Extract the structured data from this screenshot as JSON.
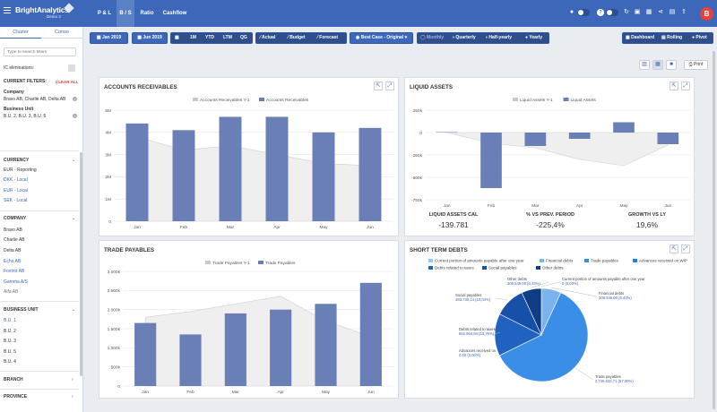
{
  "app": {
    "name": "BrightAnalytics",
    "company": "Demo 3"
  },
  "nav": {
    "tabs": [
      "P & L",
      "B / S",
      "Ratio",
      "Cashflow"
    ],
    "active": "B / S"
  },
  "user": {
    "initial": "B"
  },
  "sidebar": {
    "tabs": [
      "Cluster",
      "Conso"
    ],
    "search_placeholder": "Type to search filters",
    "ic_eliminations": "IC eliminations:",
    "current_filters": "CURRENT FILTERS:",
    "clear_all": "CLEAR ALL",
    "filter_company_label": "Company",
    "filter_company_value": "Bravo AB, Charlie AB, Delta AB",
    "filter_bu_label": "Business Unit",
    "filter_bu_value": "B.U. 2, B.U. 3, B.U. 5",
    "currency_head": "CURRENCY",
    "currencies": [
      "EUR - Reporting",
      "DKK - Local",
      "EUR - Local",
      "SEK - Local"
    ],
    "company_head": "COMPANY",
    "companies": [
      "Bravo AB",
      "Charlie AB",
      "Delta AB",
      "Echo AB",
      "Foxtrot AB",
      "Gamma A/S",
      "Alfa AB"
    ],
    "bu_head": "BUSINESS UNIT",
    "business_units": [
      "B.U. 1",
      "B.U. 2",
      "B.U. 3",
      "B.U. 5",
      "B.U. 4"
    ],
    "branch_head": "BRANCH",
    "province_head": "PROVINCE"
  },
  "toolbar": {
    "from": "Jan 2019",
    "to": "Jun 2019",
    "periods": [
      "1M",
      "YTD",
      "LTM",
      "QG"
    ],
    "actual": "Actual",
    "budget": "Budget",
    "forecast": "Forecast",
    "scenario": "Best Case - Original",
    "monthly": "Monthly",
    "quarterly": "Quarterly",
    "halfyearly": "Half-yearly",
    "yearly": "Yearly",
    "dashboard": "Dashboard",
    "rolling": "Rolling",
    "pivot": "Pivot",
    "print": "Print"
  },
  "cards": {
    "ar": {
      "title": "ACCOUNTS RECEIVABLES",
      "legend_prev": "Accounts Receivables Y-1",
      "legend_cur": "Accounts Receivables"
    },
    "la": {
      "title": "LIQUID ASSETS",
      "legend_prev": "Liquid Assets Y-1",
      "legend_cur": "Liquid Assets",
      "kpis": [
        {
          "label": "LIQUID ASSETS CAL",
          "value": "-139.781"
        },
        {
          "label": "% VS PREV. PERIOD",
          "value": "-225,4%"
        },
        {
          "label": "GROWTH VS LY",
          "value": "19,6%"
        }
      ]
    },
    "tp": {
      "title": "TRADE PAYABLES",
      "legend_prev": "Trade Payables Y-1",
      "legend_cur": "Trade Payables"
    },
    "sd": {
      "title": "SHORT TERM DEBTS"
    }
  },
  "colors": {
    "bar": "#6a7fb5",
    "area": "#efefef",
    "accent": "#3d67b8"
  },
  "chart_data": [
    {
      "type": "bar",
      "title": "ACCOUNTS RECEIVABLES",
      "categories": [
        "Jan",
        "Feb",
        "Mar",
        "Apr",
        "May",
        "Jun"
      ],
      "series": [
        {
          "name": "Accounts Receivables",
          "values": [
            4.4,
            4.1,
            4.7,
            4.7,
            4.0,
            4.2
          ]
        },
        {
          "name": "Accounts Receivables Y-1",
          "values": [
            3.8,
            3.2,
            3.4,
            3.0,
            2.6,
            2.5
          ]
        }
      ],
      "yticks": [
        "0",
        "1M",
        "2M",
        "3M",
        "4M",
        "5M"
      ],
      "ylim": [
        0,
        5
      ]
    },
    {
      "type": "bar",
      "title": "LIQUID ASSETS",
      "categories": [
        "Jan",
        "Feb",
        "Mar",
        "Apr",
        "May",
        "Jun"
      ],
      "series": [
        {
          "name": "Liquid Assets",
          "values": [
            5,
            -620,
            -150,
            -70,
            115,
            -130
          ]
        },
        {
          "name": "Liquid Assets Y-1",
          "values": [
            0,
            -120,
            -170,
            -300,
            -370,
            -140
          ]
        }
      ],
      "yticks": [
        "250k",
        "0",
        "-250k",
        "-500k",
        "-750k"
      ],
      "ylim": [
        -750,
        250
      ]
    },
    {
      "type": "bar",
      "title": "TRADE PAYABLES",
      "categories": [
        "Jan",
        "Feb",
        "Mar",
        "Apr",
        "May",
        "Jun"
      ],
      "series": [
        {
          "name": "Trade Payables",
          "values": [
            1650,
            1350,
            1900,
            2000,
            2150,
            2700
          ]
        },
        {
          "name": "Trade Payables Y-1",
          "values": [
            1800,
            1950,
            2150,
            2350,
            1700,
            1300
          ]
        }
      ],
      "yticks": [
        "0",
        "500k",
        "1.000k",
        "1.500k",
        "2.000k",
        "2.500k",
        "3.000k"
      ],
      "ylim": [
        0,
        3000
      ]
    },
    {
      "type": "pie",
      "title": "SHORT TERM DEBTS",
      "slices": [
        {
          "name": "Current portion of amounts payable after one year",
          "label_value": "0 (0,00%)",
          "percent": 0.0,
          "color": "#9cc6f3"
        },
        {
          "name": "Financial debts",
          "label_value": "309.546,00 (6,43%)",
          "percent": 6.43,
          "color": "#7ab3f0"
        },
        {
          "name": "Trade payables",
          "label_value": "2.746.533,71 (57,00%)",
          "percent": 57.0,
          "color": "#3b8ee6"
        },
        {
          "name": "Advances received on WiP",
          "label_value": "0,00 (0,00%)",
          "percent": 0.0,
          "color": "#2d7bd9"
        },
        {
          "name": "Debts related to taxes",
          "label_value": "662.964,84 (13,76%)",
          "percent": 13.76,
          "color": "#1f62c0"
        },
        {
          "name": "Social payables",
          "label_value": "483.730,14 (10,04%)",
          "percent": 10.04,
          "color": "#1650a8"
        },
        {
          "name": "Other debts",
          "label_value": "309.546,00 (6,43%)",
          "percent": 6.43,
          "color": "#0e3c85"
        }
      ],
      "legend": [
        "Current portion of amounts payable after one year",
        "Financial debts",
        "Trade payables",
        "Advances received on WiP",
        "Debts related to taxes",
        "Social payables",
        "Other debts"
      ]
    }
  ]
}
